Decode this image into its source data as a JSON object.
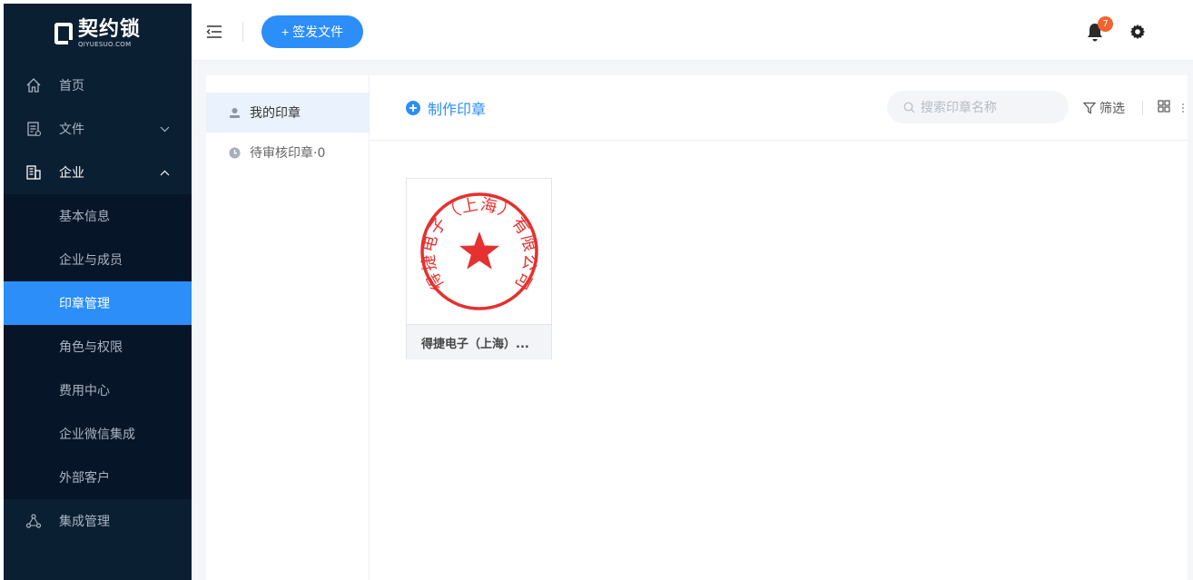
{
  "logo": {
    "name_cn": "契约锁",
    "name_en": "QIYUESUO.COM"
  },
  "sidebar": {
    "items": [
      {
        "label": "首页",
        "icon": "home-icon"
      },
      {
        "label": "文件",
        "icon": "document-icon",
        "arrow": "chevron-down"
      },
      {
        "label": "企业",
        "icon": "building-icon",
        "arrow": "chevron-up",
        "open": true
      }
    ],
    "sub_items": [
      {
        "label": "基本信息"
      },
      {
        "label": "企业与成员"
      },
      {
        "label": "印章管理",
        "active": true
      },
      {
        "label": "角色与权限"
      },
      {
        "label": "费用中心"
      },
      {
        "label": "企业微信集成"
      },
      {
        "label": "外部客户"
      }
    ],
    "integration": {
      "label": "集成管理",
      "icon": "integration-icon"
    }
  },
  "header": {
    "send_button": "+ 签发文件",
    "notification_count": "7"
  },
  "seal_panel": {
    "tabs": [
      {
        "label": "我的印章",
        "icon": "user-icon",
        "active": true
      },
      {
        "label": "待审核印章·0",
        "icon": "clock-icon"
      }
    ]
  },
  "toolbar": {
    "make_seal": "制作印章",
    "search_placeholder": "搜索印章名称",
    "filter_label": "筛选"
  },
  "seals": [
    {
      "name": "得捷电子（上海）...",
      "ring_text": "得捷电子（上海）有限公司",
      "color": "#e5312f"
    }
  ],
  "colors": {
    "accent": "#2c8ef8",
    "sidebar_bg": "#0b1f33",
    "badge": "#f0642f",
    "seal_red": "#e5312f"
  }
}
